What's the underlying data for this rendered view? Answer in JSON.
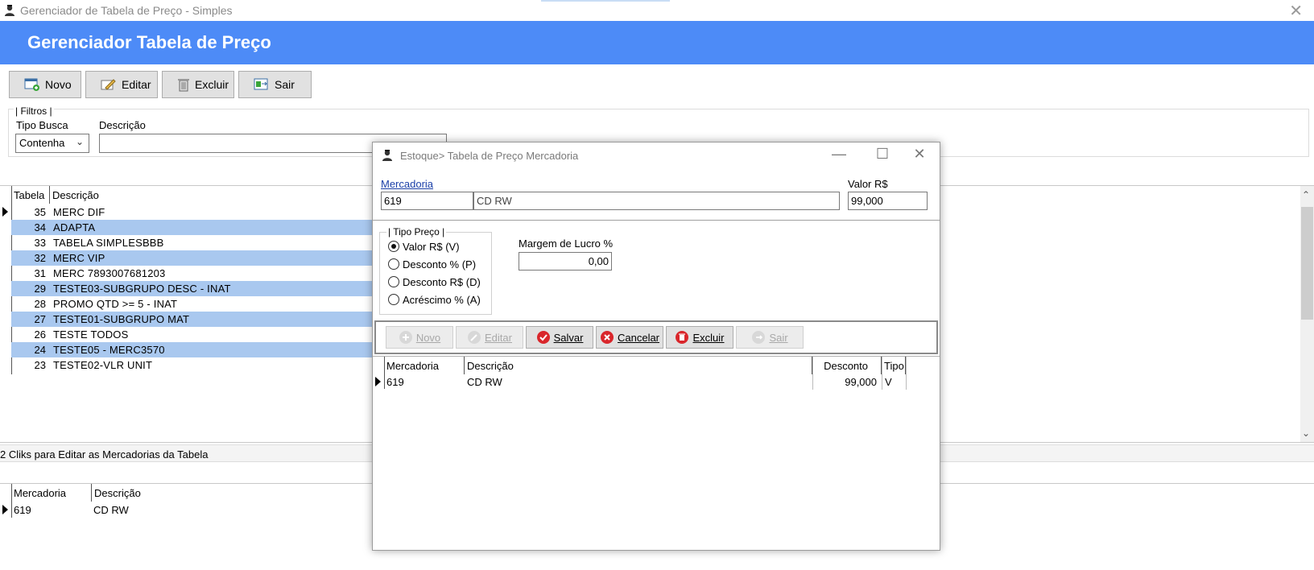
{
  "window": {
    "title": "Gerenciador de Tabela de Preço - Simples",
    "close_glyph": "✕"
  },
  "banner": {
    "title": "Gerenciador Tabela de Preço",
    "color": "#4d8bf7"
  },
  "toolbar": {
    "novo": "Novo",
    "editar": "Editar",
    "excluir": "Excluir",
    "sair": "Sair"
  },
  "filters": {
    "legend": "| Filtros |",
    "tipo_busca_label": "Tipo Busca",
    "tipo_busca_value": "Contenha",
    "descricao_label": "Descrição",
    "descricao_value": ""
  },
  "tables_grid": {
    "columns": [
      "Tabela",
      "Descrição"
    ],
    "rows": [
      {
        "tabela": "35",
        "descricao": "MERC DIF"
      },
      {
        "tabela": "34",
        "descricao": "ADAPTA"
      },
      {
        "tabela": "33",
        "descricao": "TABELA SIMPLESBBB"
      },
      {
        "tabela": "32",
        "descricao": "MERC VIP"
      },
      {
        "tabela": "31",
        "descricao": "MERC 7893007681203"
      },
      {
        "tabela": "29",
        "descricao": "TESTE03-SUBGRUPO DESC - INAT"
      },
      {
        "tabela": "28",
        "descricao": "PROMO QTD >= 5 - INAT"
      },
      {
        "tabela": "27",
        "descricao": "TESTE01-SUBGRUPO MAT"
      },
      {
        "tabela": "26",
        "descricao": "TESTE TODOS"
      },
      {
        "tabela": "24",
        "descricao": "TESTE05 - MERC3570"
      },
      {
        "tabela": "23",
        "descricao": "TESTE02-VLR UNIT"
      }
    ]
  },
  "status": {
    "hint": "2 Cliks para Editar as Mercadorias da Tabela"
  },
  "items_grid": {
    "columns": [
      "Mercadoria",
      "Descrição"
    ],
    "rows": [
      {
        "mercadoria": "619",
        "descricao": "CD RW"
      }
    ]
  },
  "dialog": {
    "title": "Estoque> Tabela de Preço Mercadoria",
    "minimize_glyph": "—",
    "maximize_glyph": "☐",
    "close_glyph": "✕",
    "mercadoria_label": "Mercadoria",
    "mercadoria_code": "619",
    "mercadoria_desc": "CD RW",
    "valor_label": "Valor R$",
    "valor_value": "99,000",
    "tipo_legend": "| Tipo Preço |",
    "tipo_options": [
      {
        "label": "Valor R$ (V)",
        "selected": true
      },
      {
        "label": "Desconto % (P)",
        "selected": false
      },
      {
        "label": "Desconto R$ (D)",
        "selected": false
      },
      {
        "label": "Acréscimo % (A)",
        "selected": false
      }
    ],
    "margem_label": "Margem de Lucro %",
    "margem_value": "0,00",
    "buttons": {
      "novo": "Novo",
      "editar": "Editar",
      "salvar": "Salvar",
      "cancelar": "Cancelar",
      "excluir": "Excluir",
      "sair": "Sair"
    },
    "grid": {
      "columns": [
        "Mercadoria",
        "Descrição",
        "Desconto",
        "Tipo"
      ],
      "rows": [
        {
          "mercadoria": "619",
          "descricao": "CD RW",
          "desconto": "99,000",
          "tipo": "V"
        }
      ]
    }
  }
}
